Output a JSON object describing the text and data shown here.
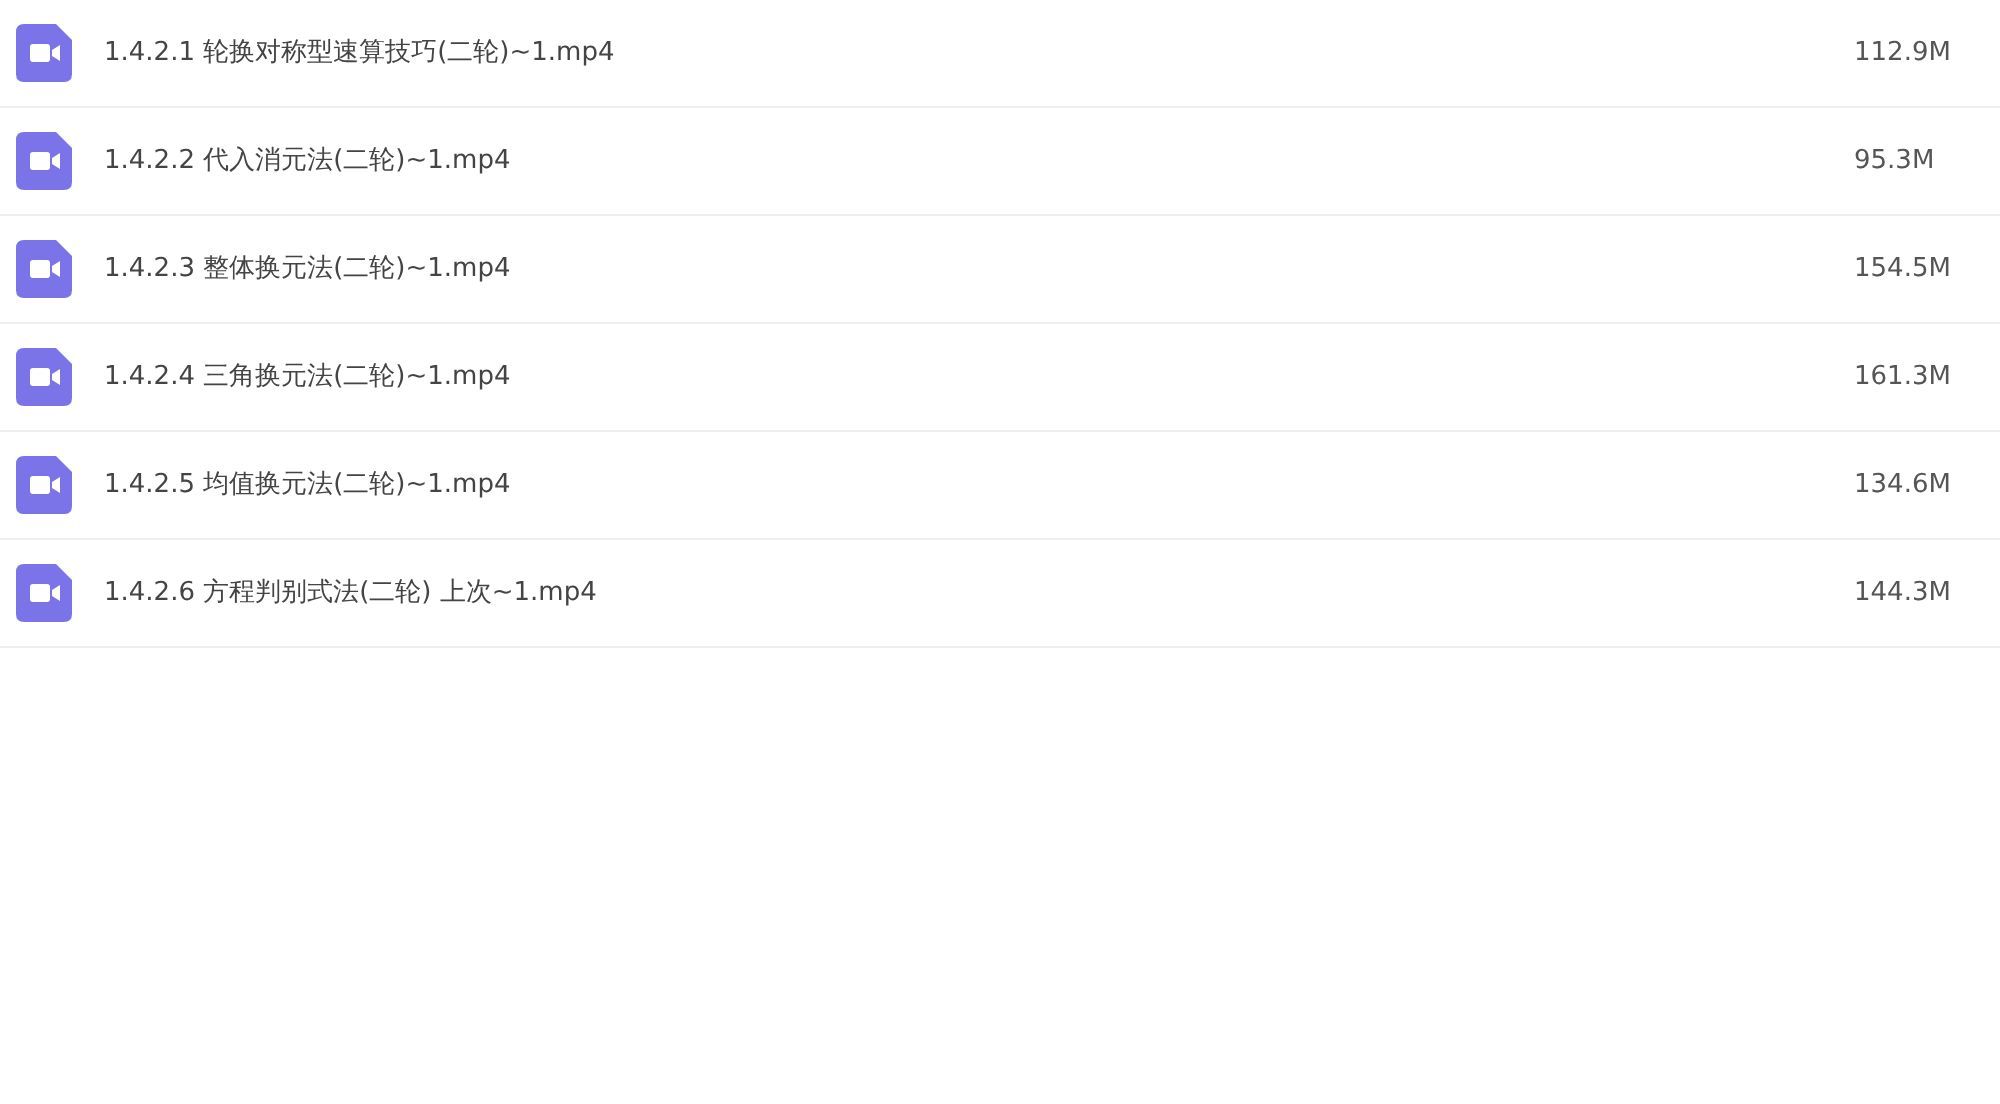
{
  "files": [
    {
      "name": "1.4.2.1 轮换对称型速算技巧(二轮)~1.mp4",
      "size": "112.9M"
    },
    {
      "name": "1.4.2.2 代入消元法(二轮)~1.mp4",
      "size": "95.3M"
    },
    {
      "name": "1.4.2.3 整体换元法(二轮)~1.mp4",
      "size": "154.5M"
    },
    {
      "name": "1.4.2.4 三角换元法(二轮)~1.mp4",
      "size": "161.3M"
    },
    {
      "name": "1.4.2.5 均值换元法(二轮)~1.mp4",
      "size": "134.6M"
    },
    {
      "name": "1.4.2.6 方程判别式法(二轮) 上次~1.mp4",
      "size": "144.3M"
    }
  ]
}
